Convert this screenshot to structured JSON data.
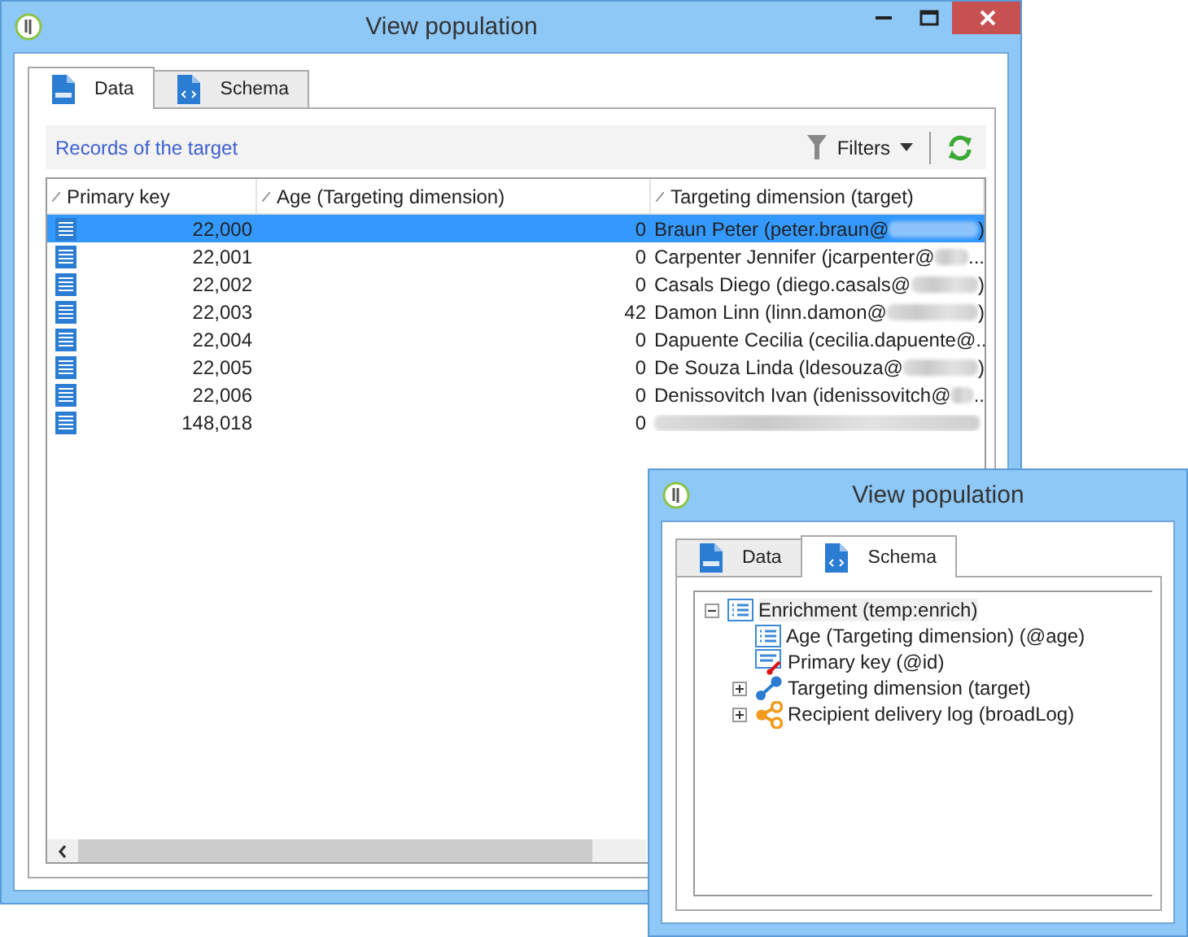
{
  "windows": [
    {
      "title": "View population",
      "tabs": [
        {
          "label": "Data",
          "kind": "sql",
          "selected": true
        },
        {
          "label": "Schema",
          "kind": "xml",
          "selected": false
        }
      ],
      "toolbar": {
        "title": "Records of the target",
        "filters": "Filters"
      },
      "table": {
        "columns": [
          "Primary key",
          "Age (Targeting dimension)",
          "Targeting dimension (target)"
        ],
        "rows": [
          {
            "key": "22,000",
            "age": "0",
            "target": "Braun Peter (peter.braun@",
            "target_end": ")",
            "selected": true
          },
          {
            "key": "22,001",
            "age": "0",
            "target": "Carpenter Jennifer (jcarpenter@",
            "target_end": "...",
            "selected": false
          },
          {
            "key": "22,002",
            "age": "0",
            "target": "Casals Diego (diego.casals@",
            "target_end": ")",
            "selected": false
          },
          {
            "key": "22,003",
            "age": "42",
            "target": "Damon Linn (linn.damon@",
            "target_end": ")",
            "selected": false
          },
          {
            "key": "22,004",
            "age": "0",
            "target": "Dapuente Cecilia (cecilia.dapuente@",
            "target_end": "..",
            "selected": false
          },
          {
            "key": "22,005",
            "age": "0",
            "target": "De Souza Linda (ldesouza@",
            "target_end": ")",
            "selected": false
          },
          {
            "key": "22,006",
            "age": "0",
            "target": "Denissovitch Ivan (idenissovitch@",
            "target_end": "..",
            "selected": false
          },
          {
            "key": "148,018",
            "age": "0",
            "selected": false
          }
        ]
      }
    },
    {
      "title": "View population",
      "tabs": [
        {
          "label": "Data",
          "kind": "sql",
          "selected": false
        },
        {
          "label": "Schema",
          "kind": "xml",
          "selected": true
        }
      ],
      "tree": [
        {
          "label": "Enrichment (temp:enrich)",
          "kind": "list",
          "selected": true,
          "expanded": true,
          "children": [
            {
              "label": "Age (Targeting dimension) (@age)",
              "kind": "list",
              "selected": false
            },
            {
              "label": "Primary key (@id)",
              "kind": "key",
              "selected": false
            },
            {
              "label": "Targeting dimension (target)",
              "kind": "link",
              "selected": false,
              "expanded": false
            },
            {
              "label": "Recipient delivery log (broadLog)",
              "kind": "share",
              "selected": false,
              "expanded": false
            }
          ]
        }
      ]
    }
  ]
}
